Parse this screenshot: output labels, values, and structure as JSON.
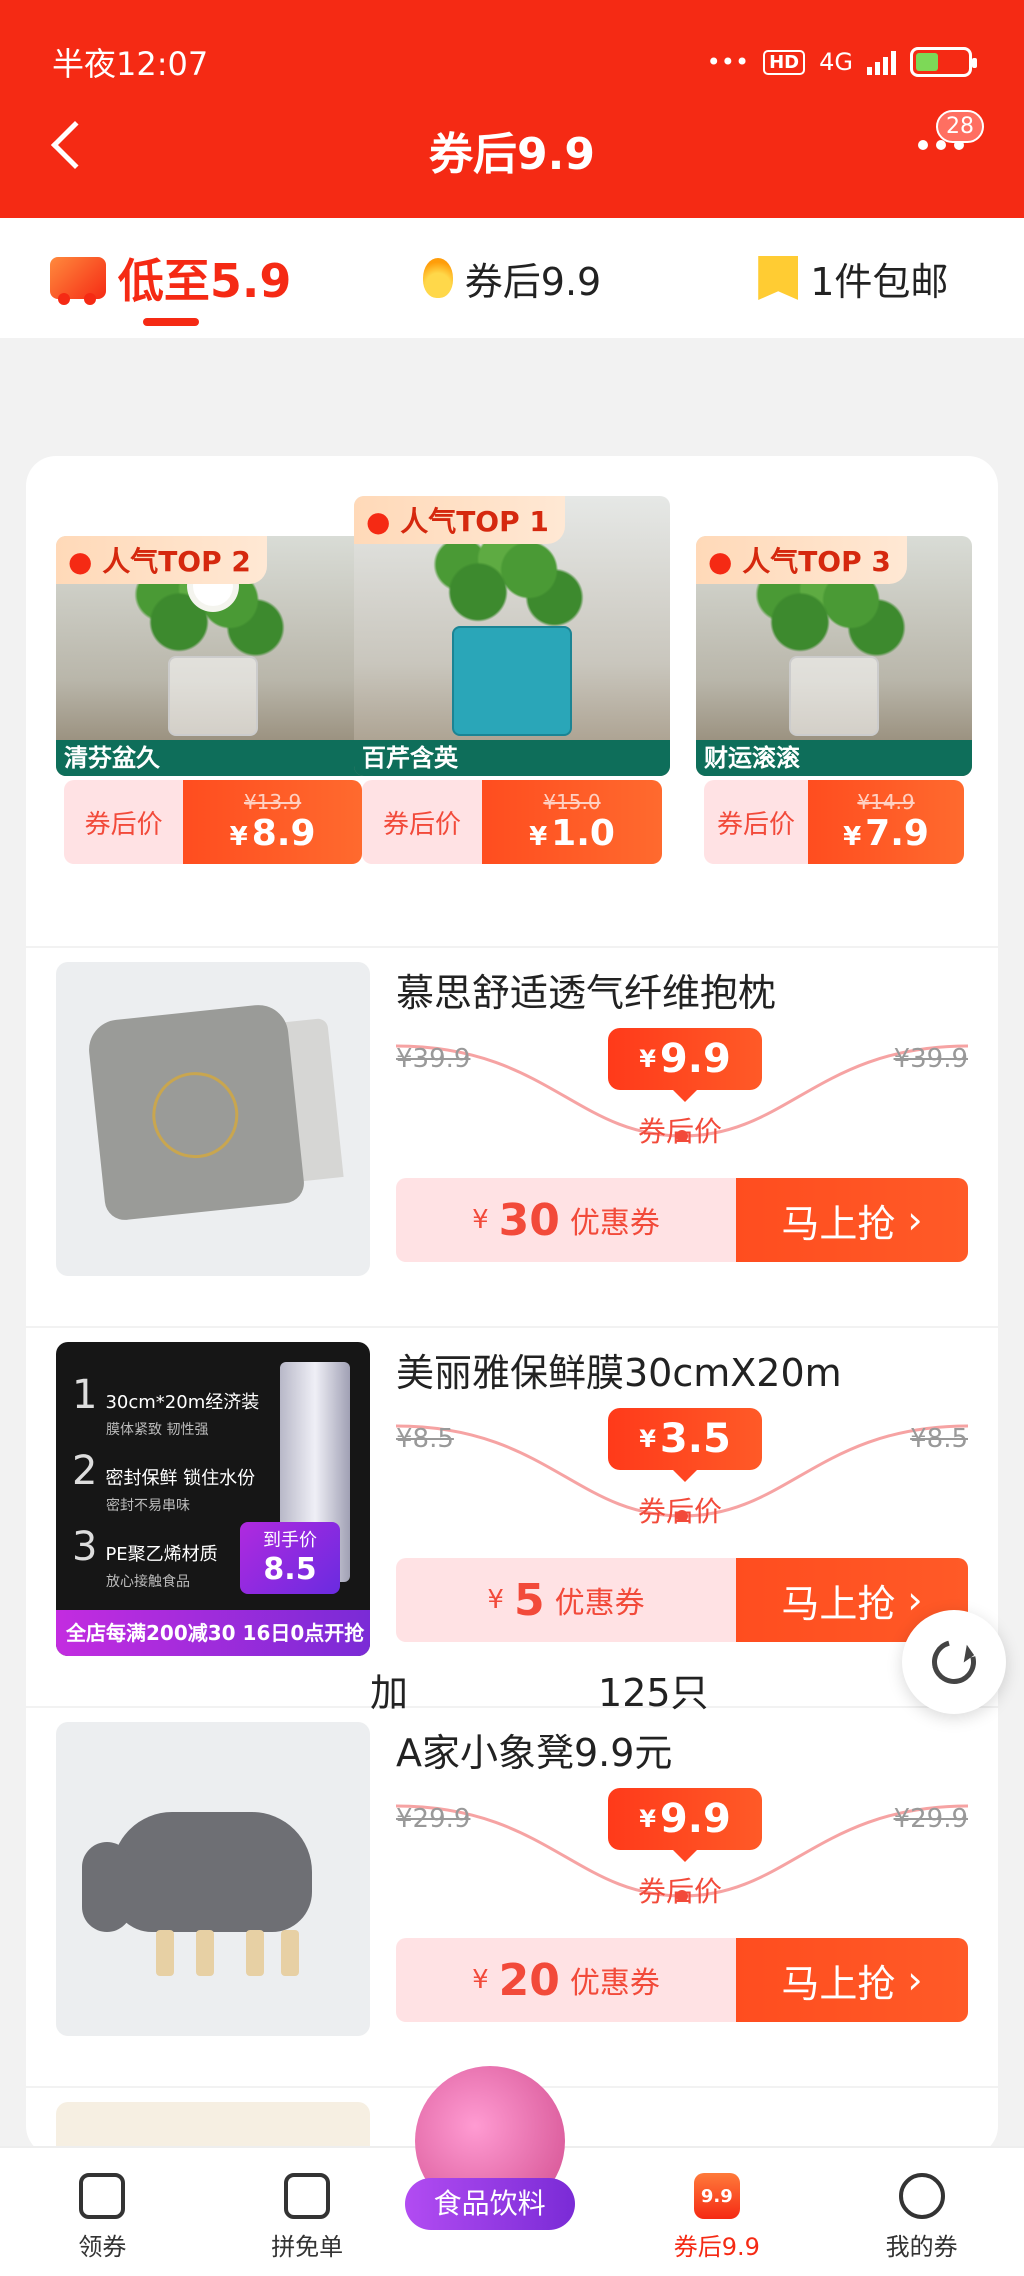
{
  "status_bar": {
    "time": "半夜12:07",
    "network": "4G",
    "hd": "HD"
  },
  "header": {
    "title": "券后9.9",
    "badge_count": "28",
    "back_icon": "back-arrow-icon",
    "more_icon": "more-dots-icon"
  },
  "tabs": [
    {
      "label": "低至5.9",
      "icon": "truck-icon",
      "active": true
    },
    {
      "label": "券后9.9",
      "icon": "flame-icon",
      "active": false
    },
    {
      "label": "1件包邮",
      "icon": "star-flag-icon",
      "active": false
    }
  ],
  "top_picks": [
    {
      "rank_label": "人气TOP 2",
      "name": "清芬盆久",
      "after_label": "券后价",
      "old_price": "¥13.9",
      "currency": "¥",
      "price": "8.9"
    },
    {
      "rank_label": "人气TOP 1",
      "name": "百芹含英",
      "after_label": "券后价",
      "old_price": "¥15.0",
      "currency": "¥",
      "price": "1.0"
    },
    {
      "rank_label": "人气TOP 3",
      "name": "财运滚滚",
      "after_label": "券后价",
      "old_price": "¥14.9",
      "currency": "¥",
      "price": "7.9"
    }
  ],
  "products": [
    {
      "title": "慕思舒适透气纤维抱枕",
      "old_price": "¥39.9",
      "price": "9.9",
      "currency": "¥",
      "after_label": "券后价",
      "coupon_value": "30",
      "coupon_label": "优惠券",
      "grab_label": "马上抢"
    },
    {
      "title": "美丽雅保鲜膜30cmX20m",
      "old_price": "¥8.5",
      "price": "3.5",
      "currency": "¥",
      "after_label": "券后价",
      "coupon_value": "5",
      "coupon_label": "优惠券",
      "grab_label": "马上抢",
      "image_text": {
        "line1": "30cm*20m经济装",
        "line1_sub": "膜体紧致 韧性强",
        "line2": "密封保鲜 锁住水份",
        "line2_sub": "密封不易串味",
        "line3": "PE聚乙烯材质",
        "line3_sub": "放心接触食品",
        "bar": "全店每满200减30  16日0点开抢",
        "tag_label": "到手价",
        "tag_price": "8.5"
      }
    },
    {
      "title": "A家小象凳9.9元",
      "old_price": "¥29.9",
      "price": "9.9",
      "currency": "¥",
      "after_label": "券后价",
      "coupon_value": "20",
      "coupon_label": "优惠券",
      "grab_label": "马上抢"
    }
  ],
  "partial_product": {
    "title_start": "加",
    "title_end": "125只"
  },
  "bottom_nav": [
    {
      "label": "领券",
      "icon": "coupon-icon"
    },
    {
      "label": "拼免单",
      "icon": "free-order-icon"
    },
    {
      "label": "食品饮料",
      "icon": "food-drink-promo"
    },
    {
      "label": "券后9.9",
      "icon": "nine-nine-icon",
      "icon_text": "9.9",
      "active": true
    },
    {
      "label": "我的券",
      "icon": "smile-icon"
    }
  ],
  "colors": {
    "brand": "#f52a14",
    "coupon_bg": "#ffe2e4",
    "promo_purple": "#7a2bd6"
  }
}
